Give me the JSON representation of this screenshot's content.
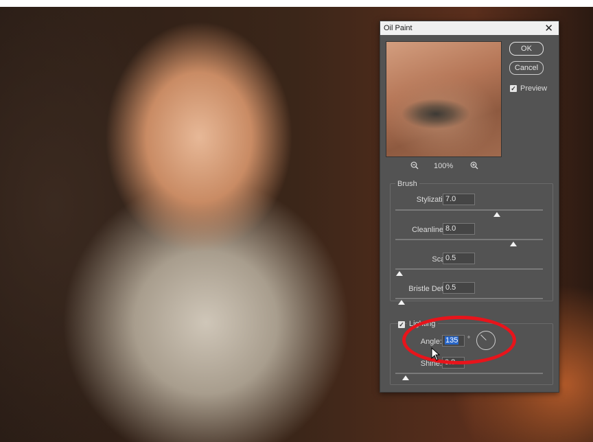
{
  "dialog": {
    "title": "Oil Paint",
    "close_label": "✕",
    "ok_label": "OK",
    "cancel_label": "Cancel",
    "preview_label": "Preview",
    "preview_checked": true,
    "zoom": "100%"
  },
  "brush": {
    "group_label": "Brush",
    "fields": [
      {
        "label": "Stylization:",
        "value": "7.0",
        "slider_fraction": 0.69
      },
      {
        "label": "Cleanliness:",
        "value": "8.0",
        "slider_fraction": 0.8
      },
      {
        "label": "Scale:",
        "value": "0.5",
        "slider_fraction": 0.03
      },
      {
        "label": "Bristle Detail:",
        "value": "0.5",
        "slider_fraction": 0.04
      }
    ]
  },
  "lighting": {
    "group_label": "Lighting",
    "checked": true,
    "angle_label": "Angle:",
    "angle_value": "135",
    "angle_unit": "°",
    "shine_label": "Shine:",
    "shine_value": "0.8",
    "shine_slider_fraction": 0.07
  },
  "colors": {
    "dialog_bg": "#535353",
    "highlight": "#2866c8",
    "annotation_red": "#e8141b"
  },
  "icons": {
    "zoom_out": "zoom-out-icon",
    "zoom_in": "zoom-in-icon",
    "close": "close-icon"
  }
}
